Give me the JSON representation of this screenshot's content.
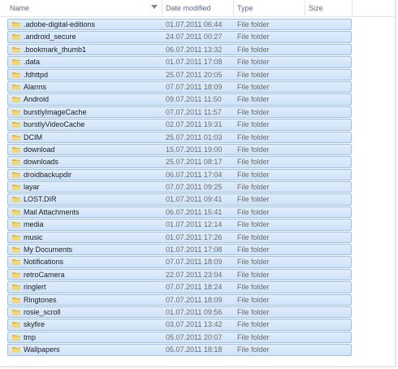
{
  "columns": {
    "name": "Name",
    "date": "Date modified",
    "type": "Type",
    "size": "Size"
  },
  "files": [
    {
      "name": ".adobe-digital-editions",
      "date": "01.07.2011 06:44",
      "type": "File folder"
    },
    {
      "name": ".android_secure",
      "date": "24.07.2011 00:27",
      "type": "File folder"
    },
    {
      "name": ".bookmark_thumb1",
      "date": "06.07.2011 13:32",
      "type": "File folder"
    },
    {
      "name": ".data",
      "date": "01.07.2011 17:08",
      "type": "File folder"
    },
    {
      "name": ".fdhttpd",
      "date": "25.07.2011 20:05",
      "type": "File folder"
    },
    {
      "name": "Alarms",
      "date": "07.07.2011 18:09",
      "type": "File folder"
    },
    {
      "name": "Android",
      "date": "09.07.2011 11:50",
      "type": "File folder"
    },
    {
      "name": "burstlyImageCache",
      "date": "07.07.2011 11:57",
      "type": "File folder"
    },
    {
      "name": "burstlyVideoCache",
      "date": "02.07.2011 19:31",
      "type": "File folder"
    },
    {
      "name": "DCIM",
      "date": "25.07.2011 01:03",
      "type": "File folder"
    },
    {
      "name": "download",
      "date": "15.07.2011 19:00",
      "type": "File folder"
    },
    {
      "name": "downloads",
      "date": "25.07.2011 08:17",
      "type": "File folder"
    },
    {
      "name": "droidbackupdir",
      "date": "06.07.2011 17:04",
      "type": "File folder"
    },
    {
      "name": "layar",
      "date": "07.07.2011 09:25",
      "type": "File folder"
    },
    {
      "name": "LOST.DIR",
      "date": "01.07.2011 09:41",
      "type": "File folder"
    },
    {
      "name": "Mail Attachments",
      "date": "06.07.2011 15:41",
      "type": "File folder"
    },
    {
      "name": "media",
      "date": "01.07.2011 12:14",
      "type": "File folder"
    },
    {
      "name": "music",
      "date": "01.07.2011 17:26",
      "type": "File folder"
    },
    {
      "name": "My Documents",
      "date": "01.07.2011 17:08",
      "type": "File folder"
    },
    {
      "name": "Notifications",
      "date": "07.07.2011 18:09",
      "type": "File folder"
    },
    {
      "name": "retroCamera",
      "date": "22.07.2011 23:04",
      "type": "File folder"
    },
    {
      "name": "ringlert",
      "date": "07.07.2011 18:24",
      "type": "File folder"
    },
    {
      "name": "Ringtones",
      "date": "07.07.2011 18:09",
      "type": "File folder"
    },
    {
      "name": "rosie_scroll",
      "date": "01.07.2011 09:56",
      "type": "File folder"
    },
    {
      "name": "skyfire",
      "date": "03.07.2011 13:42",
      "type": "File folder"
    },
    {
      "name": "tmp",
      "date": "05.07.2011 20:07",
      "type": "File folder"
    },
    {
      "name": "Wallpapers",
      "date": "05.07.2011 18:18",
      "type": "File folder"
    }
  ],
  "icons": {
    "folder": "folder-icon",
    "sort": "sort-down-icon"
  },
  "colors": {
    "selection_fill": "#d9e9fa",
    "selection_border": "#9fc0e7",
    "folder_yellow": "#e8c24a"
  }
}
